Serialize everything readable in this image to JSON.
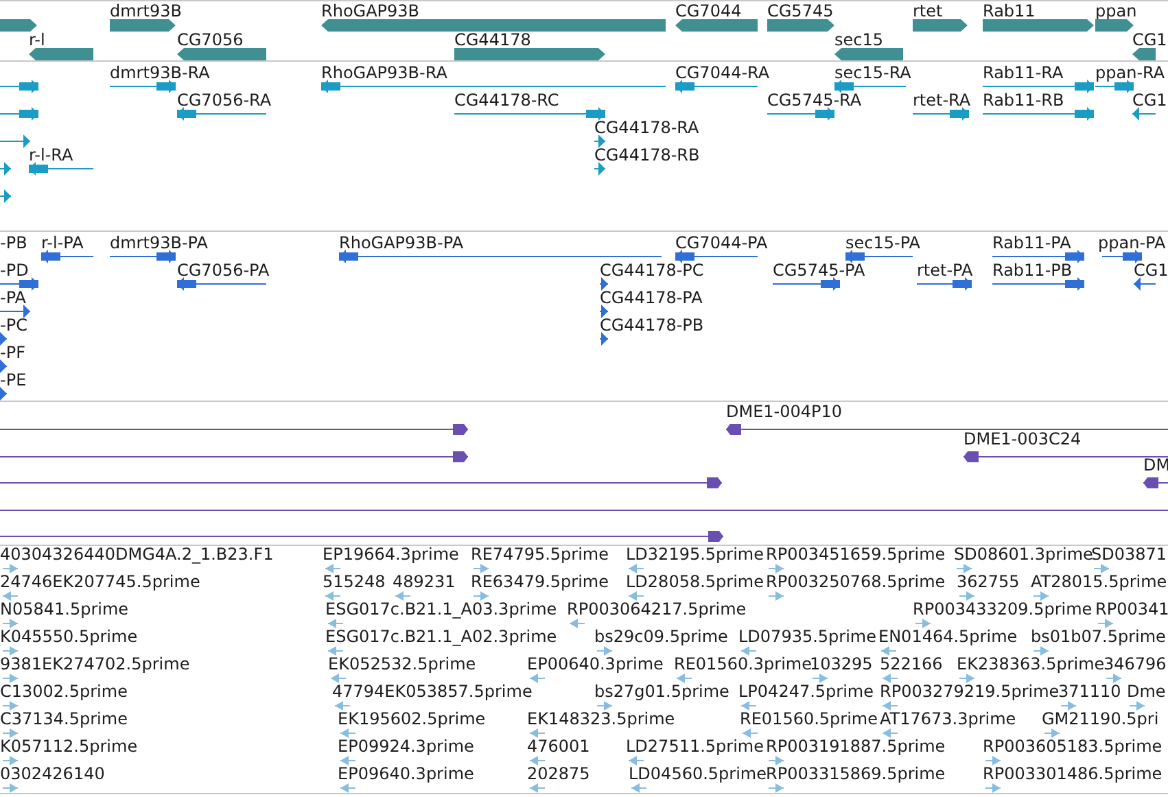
{
  "tracks": [
    {
      "kind": "genes",
      "lanes": [
        {
          "features": [
            {
              "reverse": false
            },
            {
              "label": "dmrt93B",
              "reverse": false
            },
            {
              "label": "RhoGAP93B",
              "reverse": true
            },
            {
              "label": "CG7044",
              "reverse": true
            },
            {
              "label": "CG5745",
              "reverse": false
            },
            {
              "label": "rtet",
              "reverse": false
            },
            {
              "label": "Rab11",
              "reverse": false
            },
            {
              "label": "ppan",
              "reverse": false
            }
          ]
        },
        {
          "features": [
            {
              "label": "r-l",
              "reverse": true
            },
            {
              "label": "CG7056",
              "reverse": true
            },
            {
              "label": "CG44178",
              "reverse": false
            },
            {
              "label": "sec15",
              "reverse": true
            },
            {
              "label": "CG1",
              "reverse": true
            }
          ]
        }
      ]
    },
    {
      "kind": "transcripts",
      "lanes": [
        {
          "features": [
            {
              "reverse": false
            },
            {
              "label": "dmrt93B-RA",
              "reverse": false
            },
            {
              "label": "RhoGAP93B-RA",
              "reverse": true
            },
            {
              "label": "CG7044-RA",
              "reverse": true
            },
            {
              "label": "sec15-RA",
              "reverse": true
            },
            {
              "label": "Rab11-RA",
              "reverse": false
            },
            {
              "label": "ppan-RA",
              "reverse": false
            }
          ]
        },
        {
          "features": [
            {
              "reverse": false
            },
            {
              "label": "CG7056-RA",
              "reverse": true
            },
            {
              "label": "CG44178-RC",
              "reverse": false
            },
            {
              "label": "CG5745-RA",
              "reverse": false
            },
            {
              "label": "rtet-RA",
              "reverse": false
            },
            {
              "label": "Rab11-RB",
              "reverse": false
            },
            {
              "label": "CG1",
              "reverse": true
            }
          ]
        },
        {
          "features": [
            {
              "reverse": false
            },
            {
              "label": "CG44178-RA",
              "reverse": false
            }
          ]
        },
        {
          "features": [
            {
              "reverse": false
            },
            {
              "label": "r-l-RA",
              "reverse": true
            },
            {
              "label": "CG44178-RB",
              "reverse": false
            }
          ]
        },
        {
          "features": [
            {
              "reverse": false
            }
          ]
        }
      ]
    },
    {
      "kind": "proteins",
      "lanes": [
        {
          "features": [
            {
              "label": "-PB"
            },
            {
              "label": "r-l-PA",
              "reverse": true
            },
            {
              "label": "dmrt93B-PA",
              "reverse": false
            },
            {
              "label": "RhoGAP93B-PA",
              "reverse": true
            },
            {
              "label": "CG7044-PA",
              "reverse": true
            },
            {
              "label": "sec15-PA",
              "reverse": true
            },
            {
              "label": "Rab11-PA",
              "reverse": false
            },
            {
              "label": "ppan-PA",
              "reverse": false
            }
          ]
        },
        {
          "features": [
            {
              "label": "-PD",
              "reverse": false
            },
            {
              "label": "CG7056-PA",
              "reverse": true
            },
            {
              "label": "CG44178-PC",
              "reverse": false
            },
            {
              "label": "CG5745-PA",
              "reverse": false
            },
            {
              "label": "rtet-PA",
              "reverse": false
            },
            {
              "label": "Rab11-PB",
              "reverse": false
            },
            {
              "label": "CG1",
              "reverse": true
            }
          ]
        },
        {
          "features": [
            {
              "label": "-PA",
              "reverse": false
            },
            {
              "label": "CG44178-PA",
              "reverse": false
            }
          ]
        },
        {
          "features": [
            {
              "label": "-PC",
              "reverse": false
            },
            {
              "label": "CG44178-PB",
              "reverse": false
            }
          ]
        },
        {
          "features": [
            {
              "label": "-PF",
              "reverse": false
            }
          ]
        },
        {
          "features": [
            {
              "label": "-PE",
              "reverse": false
            }
          ]
        }
      ]
    },
    {
      "kind": "clones",
      "lanes": [
        {
          "features": [
            {
              "reverse": false
            },
            {
              "label": "DME1-004P10",
              "reverse": true
            }
          ]
        },
        {
          "features": [
            {
              "reverse": false
            },
            {
              "label": "DME1-003C24",
              "reverse": true
            }
          ]
        },
        {
          "features": [
            {
              "reverse": false
            },
            {
              "label": "DM",
              "reverse": true
            }
          ]
        },
        {
          "features": [
            {
              "reverse": false
            }
          ]
        },
        {
          "features": [
            {
              "reverse": false
            }
          ]
        }
      ]
    },
    {
      "kind": "ests",
      "lanes": [
        {
          "features": [
            {
              "label": "40304326440DMG4A.2_1.B23.F1",
              "reverse": false
            },
            {
              "label": "EP19664.3prime",
              "reverse": true
            },
            {
              "label": "RE74795.5prime",
              "reverse": false
            },
            {
              "label": "LD32195.5prime",
              "reverse": true
            },
            {
              "label": "RP003451659.5prime",
              "reverse": false
            },
            {
              "label": "SD08601.3prime",
              "reverse": false
            },
            {
              "label": "SD03871",
              "reverse": false
            }
          ]
        },
        {
          "features": [
            {
              "label": "24746EK207745.5prime",
              "reverse": true
            },
            {
              "label": "515248",
              "reverse": true
            },
            {
              "label": "489231",
              "reverse": true
            },
            {
              "label": "RE63479.5prime",
              "reverse": false
            },
            {
              "label": "LD28058.5prime",
              "reverse": true
            },
            {
              "label": "RP003250768.5prime",
              "reverse": false
            },
            {
              "label": "362755",
              "reverse": false
            },
            {
              "label": "AT28015.5prime",
              "reverse": false
            }
          ]
        },
        {
          "features": [
            {
              "label": "N05841.5prime",
              "reverse": false
            },
            {
              "label": "ESG017c.B21.1_A03.3prime",
              "reverse": true
            },
            {
              "label": "RP003064217.5prime",
              "reverse": true
            },
            {
              "label": "RP003433209.5prime",
              "reverse": false
            },
            {
              "label": "RP00341",
              "reverse": false
            }
          ]
        },
        {
          "features": [
            {
              "label": "K045550.5prime",
              "reverse": false
            },
            {
              "label": "ESG017c.B21.1_A02.3prime",
              "reverse": true
            },
            {
              "label": "bs29c09.5prime",
              "reverse": false
            },
            {
              "label": "LD07935.5prime",
              "reverse": true
            },
            {
              "label": "EN01464.5prime",
              "reverse": true
            },
            {
              "label": "bs01b07.5prime",
              "reverse": false
            }
          ]
        },
        {
          "features": [
            {
              "label": "9381EK274702.5prime",
              "reverse": false
            },
            {
              "label": "EK052532.5prime",
              "reverse": true
            },
            {
              "label": "EP00640.3prime",
              "reverse": true
            },
            {
              "label": "RE01560.3prime",
              "reverse": true
            },
            {
              "label": "103295",
              "reverse": false
            },
            {
              "label": "522166",
              "reverse": true
            },
            {
              "label": "EK238363.5prime",
              "reverse": false
            },
            {
              "label": "346796",
              "reverse": false
            }
          ]
        },
        {
          "features": [
            {
              "label": "C13002.5prime",
              "reverse": false
            },
            {
              "label": "47794EK053857.5prime",
              "reverse": true
            },
            {
              "label": "bs27g01.5prime",
              "reverse": false
            },
            {
              "label": "LP04247.5prime",
              "reverse": true
            },
            {
              "label": "RP003279219.5prime",
              "reverse": true
            },
            {
              "label": "371110",
              "reverse": false
            },
            {
              "label": "Dme",
              "reverse": false
            }
          ]
        },
        {
          "features": [
            {
              "label": "C37134.5prime",
              "reverse": false
            },
            {
              "label": "EK195602.5prime",
              "reverse": true
            },
            {
              "label": "EK148323.5prime",
              "reverse": true
            },
            {
              "label": "RE01560.5prime",
              "reverse": true
            },
            {
              "label": "AT17673.3prime",
              "reverse": true
            },
            {
              "label": "GM21190.5pri",
              "reverse": false
            }
          ]
        },
        {
          "features": [
            {
              "label": "K057112.5prime",
              "reverse": false
            },
            {
              "label": "EP09924.3prime",
              "reverse": true
            },
            {
              "label": "476001",
              "reverse": true
            },
            {
              "label": "LD27511.5prime",
              "reverse": true
            },
            {
              "label": "RP003191887.5prime",
              "reverse": false
            },
            {
              "label": "RP003605183.5prime",
              "reverse": false
            }
          ]
        },
        {
          "features": [
            {
              "label": "0302426140",
              "reverse": false
            },
            {
              "label": "EP09640.3prime",
              "reverse": true
            },
            {
              "label": "202875",
              "reverse": true
            },
            {
              "label": "LD04560.5prime",
              "reverse": true
            },
            {
              "label": "RP003315869.5prime",
              "reverse": false
            },
            {
              "label": "RP003301486.5prime",
              "reverse": false
            }
          ]
        }
      ]
    }
  ]
}
